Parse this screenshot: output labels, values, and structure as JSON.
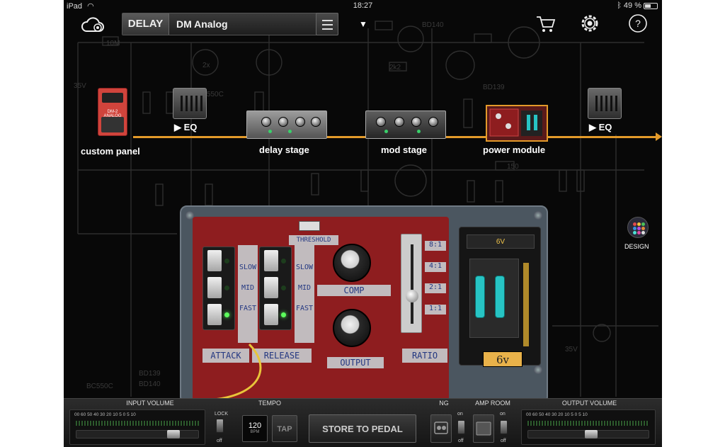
{
  "status_bar": {
    "device": "iPad",
    "time": "18:27",
    "battery": "49 %",
    "battery_level": 0.49
  },
  "top_bar": {
    "effect_type": "DELAY",
    "preset_name": "DM Analog",
    "caret": "▼"
  },
  "signal_chain": {
    "items": [
      {
        "id": "custom-panel",
        "label": "custom panel"
      },
      {
        "id": "eq-pre",
        "label": "▶ EQ"
      },
      {
        "id": "delay-stage",
        "label": "delay stage"
      },
      {
        "id": "mod-stage",
        "label": "mod stage"
      },
      {
        "id": "power-module",
        "label": "power module",
        "selected": true
      },
      {
        "id": "eq-post",
        "label": "▶ EQ"
      }
    ],
    "stomp_label": "DM-2 ANALOG"
  },
  "design": {
    "label": "DESIGN"
  },
  "pedal": {
    "attack_label": "ATTACK",
    "release_label": "RELEASE",
    "comp_label": "COMP",
    "output_label": "OUTPUT",
    "ratio_label": "RATIO",
    "threshold_label": "THRESHOLD",
    "slow": "SLOW",
    "mid": "MID",
    "fast": "FAST",
    "ratio_marks": [
      "8:1",
      "4:1",
      "2:1",
      "1:1"
    ],
    "ratio_setting": "2:1",
    "attack_setting": "FAST",
    "release_setting": "FAST",
    "battery_display": "6V",
    "battery_note": "6v"
  },
  "bottom_bar": {
    "input_volume": {
      "title": "INPUT VOLUME",
      "scale": "00  60  50  40  30  20  10   5   0   5   10"
    },
    "lock": {
      "label": "LOCK",
      "state": "off"
    },
    "tempo": {
      "title": "TEMPO",
      "value": "120",
      "unit": "BPM",
      "tap_label": "TAP"
    },
    "store_label": "STORE TO PEDAL",
    "ng": {
      "title": "NG",
      "on": "on",
      "off": "off"
    },
    "amp_room": {
      "title": "AMP ROOM",
      "on": "on",
      "off": "off"
    },
    "output_volume": {
      "title": "OUTPUT VOLUME",
      "scale": "00  60  50  40  30  20  10   5   0   5   10"
    }
  },
  "colors": {
    "chain": "#e39a2a",
    "pcb": "#8e1d1f",
    "led_on": "#5cff5c",
    "cell": "#27c4c4"
  },
  "icons": [
    "cloud-icon",
    "menu-icon",
    "cart-icon",
    "settings-icon",
    "help-icon",
    "design-icon"
  ]
}
